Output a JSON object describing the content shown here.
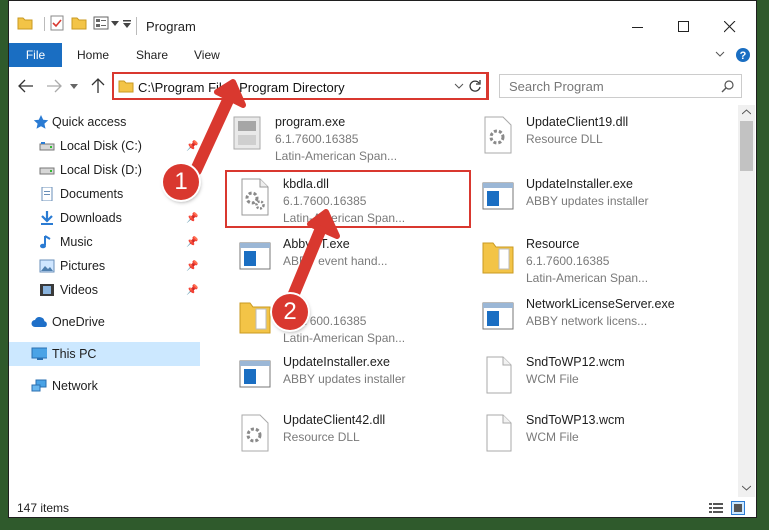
{
  "title": "Program",
  "ribbon": {
    "file": "File",
    "home": "Home",
    "share": "Share",
    "view": "View"
  },
  "address": {
    "path": "C:\\Program Files\\Program Directory"
  },
  "search": {
    "placeholder": "Search Program"
  },
  "nav": {
    "items": [
      {
        "label": "Quick access",
        "icon": "star-icon",
        "pinned": false
      },
      {
        "label": "Local Disk (C:)",
        "icon": "drive-icon",
        "pinned": true
      },
      {
        "label": "Local Disk (D:)",
        "icon": "drive-icon",
        "pinned": true
      },
      {
        "label": "Documents",
        "icon": "document-icon",
        "pinned": true
      },
      {
        "label": "Downloads",
        "icon": "download-icon",
        "pinned": true
      },
      {
        "label": "Music",
        "icon": "music-icon",
        "pinned": true
      },
      {
        "label": "Pictures",
        "icon": "picture-icon",
        "pinned": true
      },
      {
        "label": "Videos",
        "icon": "video-icon",
        "pinned": true
      },
      {
        "label": "OneDrive",
        "icon": "cloud-icon",
        "pinned": false
      },
      {
        "label": "This PC",
        "icon": "computer-icon",
        "pinned": false
      },
      {
        "label": "Network",
        "icon": "network-icon",
        "pinned": false
      }
    ]
  },
  "files": [
    {
      "name": "program.exe",
      "line1": "6.1.7600.16385",
      "line2": "Latin-American Span...",
      "icon": "exe-icon"
    },
    {
      "name": "UpdateClient19.dll",
      "line1": "Resource DLL",
      "line2": "",
      "icon": "dll-icon"
    },
    {
      "name": "kbdla.dll",
      "line1": "6.1.7600.16385",
      "line2": "Latin-American Span...",
      "icon": "dll-icon"
    },
    {
      "name": "UpdateInstaller.exe",
      "line1": "ABBY updates installer",
      "line2": "",
      "icon": "app-window-icon"
    },
    {
      "name": "AbbyST.exe",
      "line1": "ABBY event hand...",
      "line2": "",
      "icon": "app-window-icon"
    },
    {
      "name": "Resource",
      "line1": "6.1.7600.16385",
      "line2": "Latin-American Span...",
      "icon": "folder-icon"
    },
    {
      "name": "",
      "line1": "6.1.7600.16385",
      "line2": "Latin-American Span...",
      "icon": "folder-icon"
    },
    {
      "name": "NetworkLicenseServer.exe",
      "line1": "ABBY network licens...",
      "line2": "",
      "icon": "app-window-icon"
    },
    {
      "name": "UpdateInstaller.exe",
      "line1": "ABBY updates installer",
      "line2": "",
      "icon": "app-window-icon"
    },
    {
      "name": "SndToWP12.wcm",
      "line1": "WCM File",
      "line2": "",
      "icon": "blank-file-icon"
    },
    {
      "name": "UpdateClient42.dll",
      "line1": "Resource DLL",
      "line2": "",
      "icon": "dll-icon"
    },
    {
      "name": "SndToWP13.wcm",
      "line1": "WCM File",
      "line2": "",
      "icon": "blank-file-icon"
    }
  ],
  "status": {
    "count": "147 items"
  },
  "callouts": {
    "one": "1",
    "two": "2"
  },
  "colors": {
    "accent": "#1a6ec2",
    "highlight": "#d9382f",
    "selection": "#cce8ff"
  }
}
